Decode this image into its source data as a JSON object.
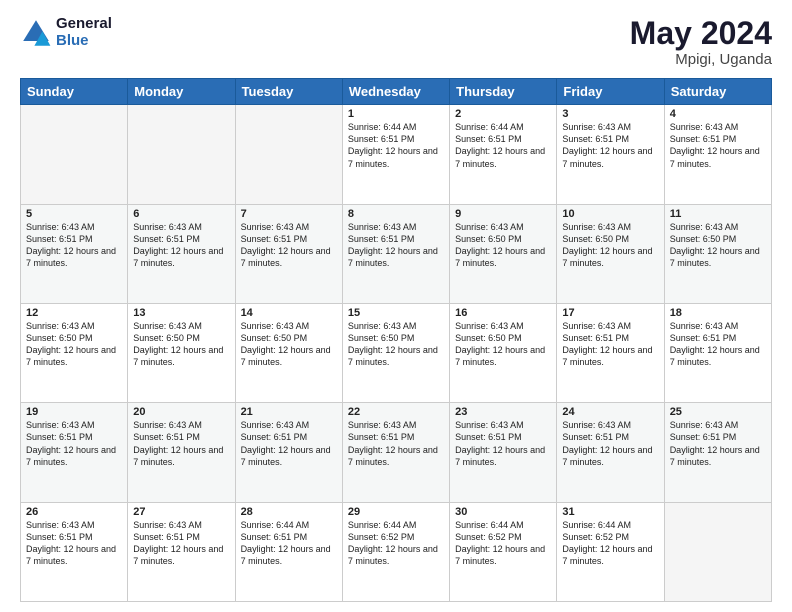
{
  "logo": {
    "text_general": "General",
    "text_blue": "Blue"
  },
  "header": {
    "title": "May 2024",
    "subtitle": "Mpigi, Uganda"
  },
  "weekdays": [
    "Sunday",
    "Monday",
    "Tuesday",
    "Wednesday",
    "Thursday",
    "Friday",
    "Saturday"
  ],
  "weeks": [
    [
      {
        "day": "",
        "info": ""
      },
      {
        "day": "",
        "info": ""
      },
      {
        "day": "",
        "info": ""
      },
      {
        "day": "1",
        "info": "Sunrise: 6:44 AM\nSunset: 6:51 PM\nDaylight: 12 hours and 7 minutes."
      },
      {
        "day": "2",
        "info": "Sunrise: 6:44 AM\nSunset: 6:51 PM\nDaylight: 12 hours and 7 minutes."
      },
      {
        "day": "3",
        "info": "Sunrise: 6:43 AM\nSunset: 6:51 PM\nDaylight: 12 hours and 7 minutes."
      },
      {
        "day": "4",
        "info": "Sunrise: 6:43 AM\nSunset: 6:51 PM\nDaylight: 12 hours and 7 minutes."
      }
    ],
    [
      {
        "day": "5",
        "info": "Sunrise: 6:43 AM\nSunset: 6:51 PM\nDaylight: 12 hours and 7 minutes."
      },
      {
        "day": "6",
        "info": "Sunrise: 6:43 AM\nSunset: 6:51 PM\nDaylight: 12 hours and 7 minutes."
      },
      {
        "day": "7",
        "info": "Sunrise: 6:43 AM\nSunset: 6:51 PM\nDaylight: 12 hours and 7 minutes."
      },
      {
        "day": "8",
        "info": "Sunrise: 6:43 AM\nSunset: 6:51 PM\nDaylight: 12 hours and 7 minutes."
      },
      {
        "day": "9",
        "info": "Sunrise: 6:43 AM\nSunset: 6:50 PM\nDaylight: 12 hours and 7 minutes."
      },
      {
        "day": "10",
        "info": "Sunrise: 6:43 AM\nSunset: 6:50 PM\nDaylight: 12 hours and 7 minutes."
      },
      {
        "day": "11",
        "info": "Sunrise: 6:43 AM\nSunset: 6:50 PM\nDaylight: 12 hours and 7 minutes."
      }
    ],
    [
      {
        "day": "12",
        "info": "Sunrise: 6:43 AM\nSunset: 6:50 PM\nDaylight: 12 hours and 7 minutes."
      },
      {
        "day": "13",
        "info": "Sunrise: 6:43 AM\nSunset: 6:50 PM\nDaylight: 12 hours and 7 minutes."
      },
      {
        "day": "14",
        "info": "Sunrise: 6:43 AM\nSunset: 6:50 PM\nDaylight: 12 hours and 7 minutes."
      },
      {
        "day": "15",
        "info": "Sunrise: 6:43 AM\nSunset: 6:50 PM\nDaylight: 12 hours and 7 minutes."
      },
      {
        "day": "16",
        "info": "Sunrise: 6:43 AM\nSunset: 6:50 PM\nDaylight: 12 hours and 7 minutes."
      },
      {
        "day": "17",
        "info": "Sunrise: 6:43 AM\nSunset: 6:51 PM\nDaylight: 12 hours and 7 minutes."
      },
      {
        "day": "18",
        "info": "Sunrise: 6:43 AM\nSunset: 6:51 PM\nDaylight: 12 hours and 7 minutes."
      }
    ],
    [
      {
        "day": "19",
        "info": "Sunrise: 6:43 AM\nSunset: 6:51 PM\nDaylight: 12 hours and 7 minutes."
      },
      {
        "day": "20",
        "info": "Sunrise: 6:43 AM\nSunset: 6:51 PM\nDaylight: 12 hours and 7 minutes."
      },
      {
        "day": "21",
        "info": "Sunrise: 6:43 AM\nSunset: 6:51 PM\nDaylight: 12 hours and 7 minutes."
      },
      {
        "day": "22",
        "info": "Sunrise: 6:43 AM\nSunset: 6:51 PM\nDaylight: 12 hours and 7 minutes."
      },
      {
        "day": "23",
        "info": "Sunrise: 6:43 AM\nSunset: 6:51 PM\nDaylight: 12 hours and 7 minutes."
      },
      {
        "day": "24",
        "info": "Sunrise: 6:43 AM\nSunset: 6:51 PM\nDaylight: 12 hours and 7 minutes."
      },
      {
        "day": "25",
        "info": "Sunrise: 6:43 AM\nSunset: 6:51 PM\nDaylight: 12 hours and 7 minutes."
      }
    ],
    [
      {
        "day": "26",
        "info": "Sunrise: 6:43 AM\nSunset: 6:51 PM\nDaylight: 12 hours and 7 minutes."
      },
      {
        "day": "27",
        "info": "Sunrise: 6:43 AM\nSunset: 6:51 PM\nDaylight: 12 hours and 7 minutes."
      },
      {
        "day": "28",
        "info": "Sunrise: 6:44 AM\nSunset: 6:51 PM\nDaylight: 12 hours and 7 minutes."
      },
      {
        "day": "29",
        "info": "Sunrise: 6:44 AM\nSunset: 6:52 PM\nDaylight: 12 hours and 7 minutes."
      },
      {
        "day": "30",
        "info": "Sunrise: 6:44 AM\nSunset: 6:52 PM\nDaylight: 12 hours and 7 minutes."
      },
      {
        "day": "31",
        "info": "Sunrise: 6:44 AM\nSunset: 6:52 PM\nDaylight: 12 hours and 7 minutes."
      },
      {
        "day": "",
        "info": ""
      }
    ]
  ]
}
